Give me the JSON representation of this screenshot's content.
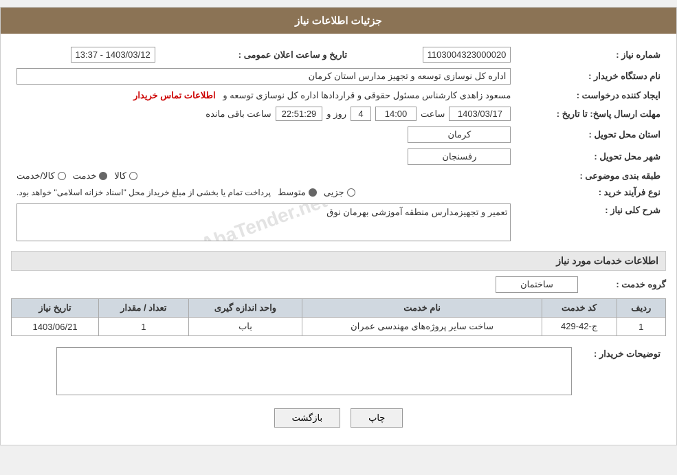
{
  "header": {
    "title": "جزئیات اطلاعات نیاز"
  },
  "fields": {
    "request_number_label": "شماره نیاز :",
    "request_number_value": "1103004323000020",
    "org_name_label": "نام دستگاه خریدار :",
    "org_name_value": "اداره کل نوسازی  توسعه و تجهیز مدارس استان کرمان",
    "creator_label": "ایجاد کننده درخواست :",
    "creator_value": "مسعود زاهدی کارشناس مسئول حقوقی و قراردادها اداره کل نوسازی  توسعه و",
    "contact_info_link": "اطلاعات تماس خریدار",
    "deadline_label": "مهلت ارسال پاسخ: تا تاریخ :",
    "deadline_date": "1403/03/17",
    "deadline_time_label": "ساعت",
    "deadline_time": "14:00",
    "deadline_days_label": "روز و",
    "deadline_days": "4",
    "deadline_remaining_label": "ساعت باقی مانده",
    "deadline_remaining": "22:51:29",
    "announce_date_label": "تاریخ و ساعت اعلان عمومی :",
    "announce_date": "1403/03/12 - 13:37",
    "province_label": "استان محل تحویل :",
    "province_value": "کرمان",
    "city_label": "شهر محل تحویل :",
    "city_value": "رفسنجان",
    "category_label": "طبقه بندی موضوعی :",
    "category_kala": "کالا",
    "category_khadamat": "خدمت",
    "category_kala_khadamat": "کالا/خدمت",
    "category_selected": "khadamat",
    "process_label": "نوع فرآیند خرید :",
    "process_jazii": "جزیی",
    "process_motavaset": "متوسط",
    "process_note": "پرداخت تمام یا بخشی از مبلغ خریداز محل \"اسناد خزانه اسلامی\" خواهد بود.",
    "process_selected": "motavaset",
    "description_label": "شرح کلی نیاز :",
    "description_value": "تعمیر و تجهیزمدارس منطقه آموزشی بهرمان نوق",
    "services_section_title": "اطلاعات خدمات مورد نیاز",
    "service_group_label": "گروه خدمت :",
    "service_group_value": "ساختمان",
    "table_headers": {
      "row_num": "ردیف",
      "service_code": "کد خدمت",
      "service_name": "نام خدمت",
      "unit": "واحد اندازه گیری",
      "quantity": "تعداد / مقدار",
      "date": "تاریخ نیاز"
    },
    "table_rows": [
      {
        "row_num": "1",
        "service_code": "ج-42-429",
        "service_name": "ساخت سایر پروژه‌های مهندسی عمران",
        "unit": "باب",
        "quantity": "1",
        "date": "1403/06/21"
      }
    ],
    "buyer_desc_label": "توضیحات خریدار :",
    "buyer_desc_value": "",
    "btn_back": "بازگشت",
    "btn_print": "چاپ"
  }
}
